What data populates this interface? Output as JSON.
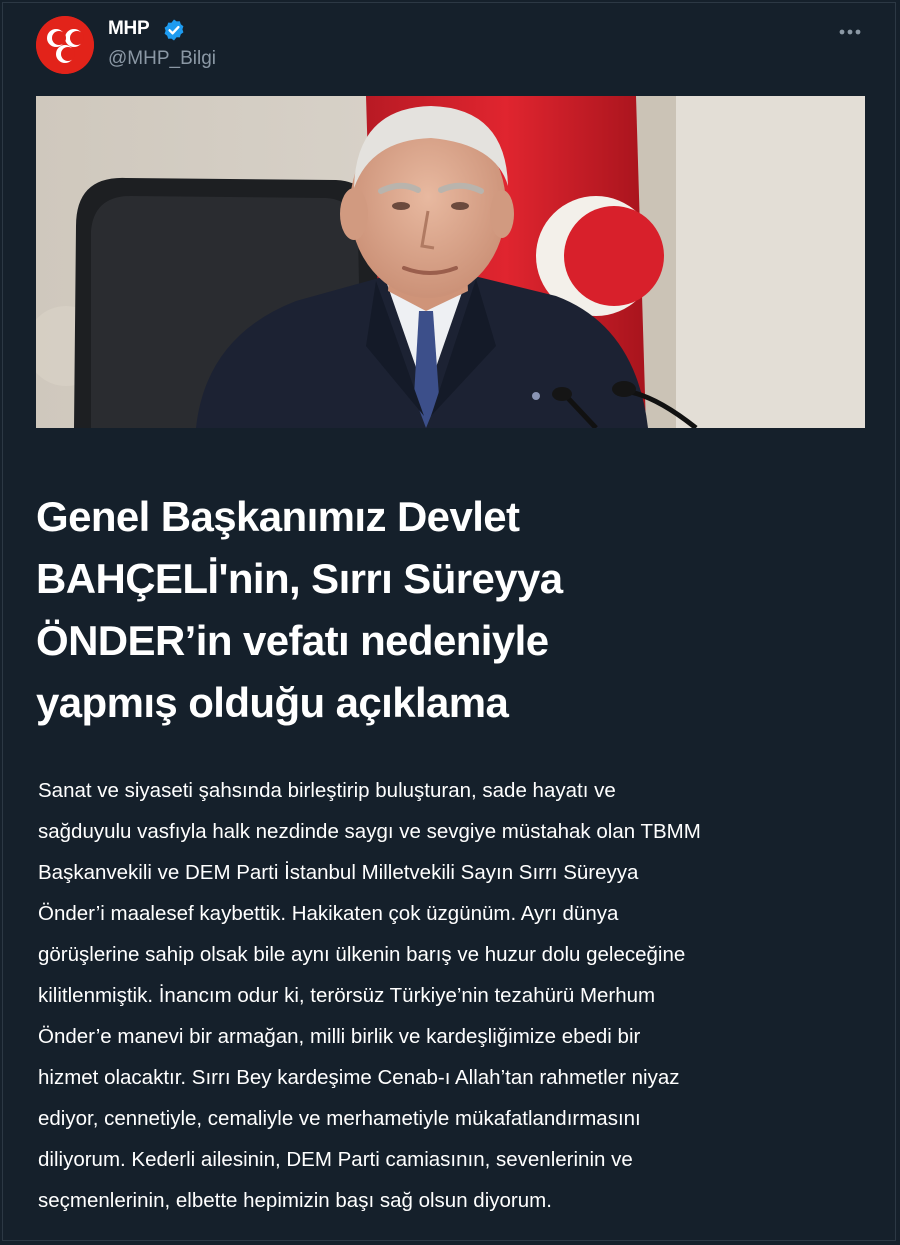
{
  "author": {
    "display_name": "MHP",
    "handle": "@MHP_Bilgi",
    "verified": true,
    "avatar_icon": "mhp-logo-icon",
    "brand_color": "#e2231a",
    "verified_color": "#1d9bf0"
  },
  "menu": {
    "more_icon": "more-horizontal-icon"
  },
  "media": {
    "subject": "speaker-at-podium-photo"
  },
  "post": {
    "headline_lines": [
      "Genel Başkanımız Devlet",
      "BAHÇELİ'nin, Sırrı Süreyya",
      "ÖNDER’in vefatı nedeniyle",
      "yapmış olduğu açıklama"
    ],
    "body_lines": [
      "Sanat ve siyaseti şahsında birleştirip buluşturan, sade hayatı ve",
      "sağduyulu vasfıyla halk nezdinde saygı ve sevgiye müstahak olan TBMM",
      "Başkanvekili ve DEM Parti İstanbul Milletvekili Sayın Sırrı Süreyya",
      "Önder’i maalesef kaybettik. Hakikaten çok üzgünüm. Ayrı dünya",
      "görüşlerine sahip olsak bile aynı ülkenin barış ve huzur dolu geleceğine",
      "kilitlenmiştik. İnancım odur ki, terörsüz Türkiye’nin tezahürü Merhum",
      "Önder’e manevi bir armağan, milli birlik ve kardeşliğimize ebedi bir",
      "hizmet olacaktır. Sırrı Bey kardeşime Cenab-ı Allah’tan rahmetler niyaz",
      "ediyor, cennetiyle, cemaliyle ve merhametiyle mükafatlandırmasını",
      "diliyorum. Kederli ailesinin, DEM Parti camiasının, sevenlerinin ve",
      "seçmenlerinin, elbette hepimizin başı sağ olsun diyorum."
    ]
  },
  "colors": {
    "background": "#15202b",
    "text": "#ffffff",
    "secondary_text": "#8b98a5",
    "flag_red": "#d8202b"
  }
}
